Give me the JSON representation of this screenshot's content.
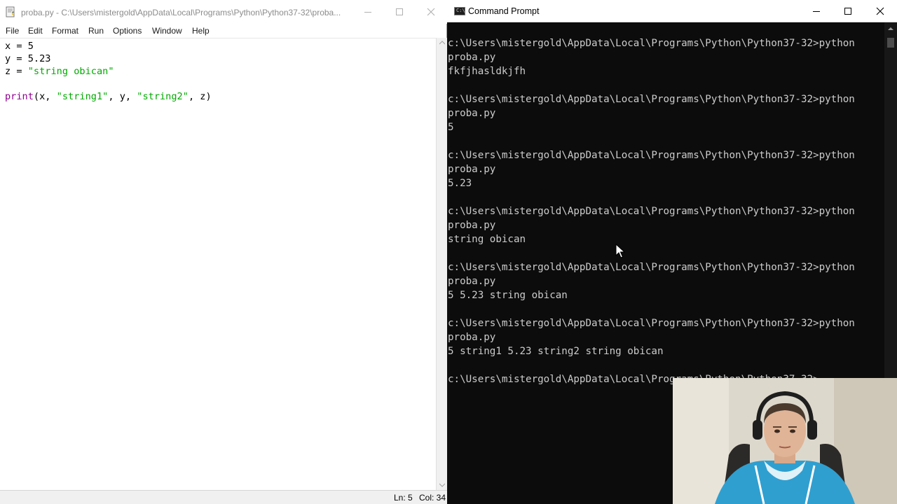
{
  "idle": {
    "title": "proba.py - C:\\Users\\mistergold\\AppData\\Local\\Programs\\Python\\Python37-32\\proba...",
    "menu": [
      "File",
      "Edit",
      "Format",
      "Run",
      "Options",
      "Window",
      "Help"
    ],
    "code": {
      "line1": "x = 5",
      "line2": "y = 5.23",
      "line3_prefix": "z = ",
      "line3_string": "\"string obican\"",
      "line5_kw": "print",
      "line5_a": "(x, ",
      "line5_s1": "\"string1\"",
      "line5_b": ", y, ",
      "line5_s2": "\"string2\"",
      "line5_c": ", z)"
    },
    "status": {
      "ln": "Ln: 5",
      "col": "Col: 34"
    }
  },
  "cmd": {
    "title": "Command Prompt",
    "icon_text": "C:\\",
    "lines": [
      "c:\\Users\\mistergold\\AppData\\Local\\Programs\\Python\\Python37-32>python",
      "proba.py",
      "fkfjhasldkjfh",
      "",
      "c:\\Users\\mistergold\\AppData\\Local\\Programs\\Python\\Python37-32>python",
      "proba.py",
      "5",
      "",
      "c:\\Users\\mistergold\\AppData\\Local\\Programs\\Python\\Python37-32>python",
      "proba.py",
      "5.23",
      "",
      "c:\\Users\\mistergold\\AppData\\Local\\Programs\\Python\\Python37-32>python",
      "proba.py",
      "string obican",
      "",
      "c:\\Users\\mistergold\\AppData\\Local\\Programs\\Python\\Python37-32>python",
      "proba.py",
      "5 5.23 string obican",
      "",
      "c:\\Users\\mistergold\\AppData\\Local\\Programs\\Python\\Python37-32>python",
      "proba.py",
      "5 string1 5.23 string2 string obican",
      "",
      "c:\\Users\\mistergold\\AppData\\Local\\Programs\\Python\\Python37-32>"
    ]
  },
  "colors": {
    "idle_keyword": "#900090",
    "idle_string": "#00aa00",
    "console_bg": "#0c0c0c",
    "console_text": "#cccccc"
  },
  "icons": [
    "idle-app-icon",
    "minimize-icon",
    "maximize-icon",
    "close-icon",
    "cmd-app-icon",
    "mouse-cursor-icon"
  ]
}
